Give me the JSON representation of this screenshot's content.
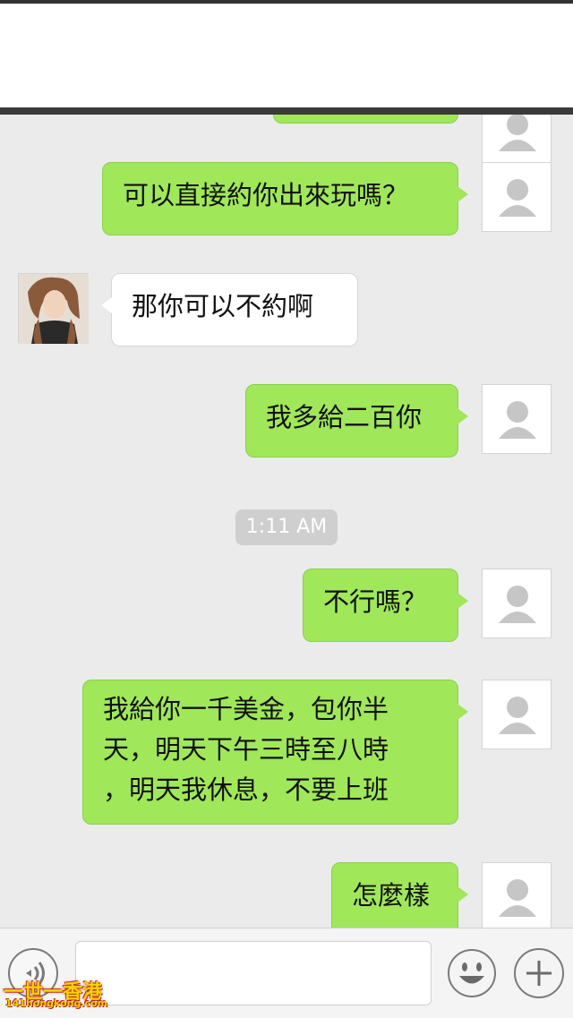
{
  "messages": {
    "m0": "",
    "m1": "可以直接約你出來玩嗎？",
    "m2": "那你可以不約啊",
    "m3": "我多給二百你",
    "m4": "不行嗎？",
    "m5": "我給你一千美金，包你半\n天，明天下午三時至八時\n，明天我休息，不要上班",
    "m6": "怎麼樣"
  },
  "timestamp": "1:11 AM",
  "watermark": {
    "name": "一世一香港",
    "url": "141hongkong.com"
  },
  "colors": {
    "sent_bubble": "#a0e75a",
    "received_bubble": "#ffffff",
    "background": "#ebebeb"
  },
  "icons": {
    "voice": "voice-icon",
    "emoji": "emoji-icon",
    "plus": "plus-icon",
    "avatar_placeholder": "person-silhouette-icon"
  }
}
